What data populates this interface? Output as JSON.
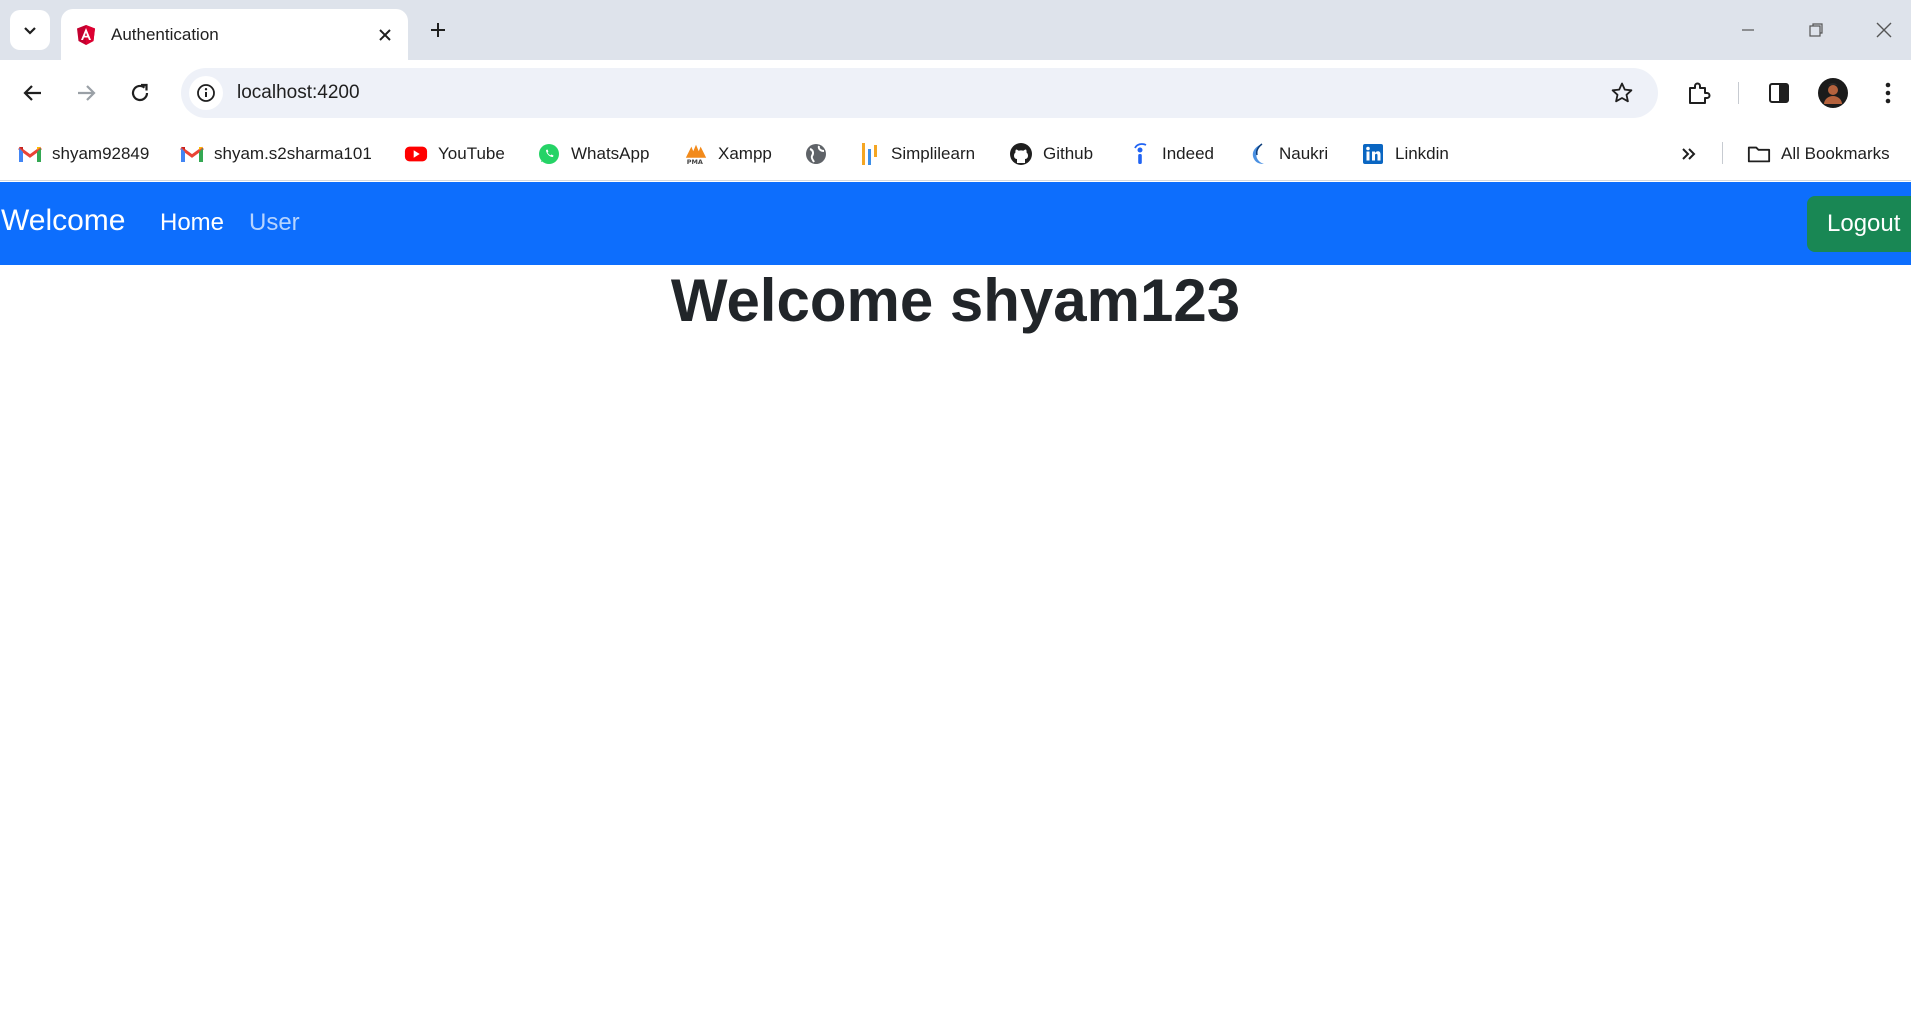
{
  "browser": {
    "tab_title": "Authentication",
    "url": "localhost:4200",
    "bookmarks": [
      {
        "label": "shyam92849",
        "icon": "gmail-icon"
      },
      {
        "label": "shyam.s2sharma101",
        "icon": "gmail-icon"
      },
      {
        "label": "YouTube",
        "icon": "youtube-icon"
      },
      {
        "label": "WhatsApp",
        "icon": "whatsapp-icon"
      },
      {
        "label": "Xampp",
        "icon": "xampp-icon"
      },
      {
        "label": "",
        "icon": "globe-icon"
      },
      {
        "label": "Simplilearn",
        "icon": "simplilearn-icon"
      },
      {
        "label": "Github",
        "icon": "github-icon"
      },
      {
        "label": "Indeed",
        "icon": "indeed-icon"
      },
      {
        "label": "Naukri",
        "icon": "naukri-icon"
      },
      {
        "label": "Linkdin",
        "icon": "linkedin-icon"
      }
    ],
    "all_bookmarks_label": "All Bookmarks"
  },
  "app": {
    "brand": "Welcome",
    "nav": [
      {
        "label": "Home",
        "active": true
      },
      {
        "label": "User",
        "active": false
      }
    ],
    "logout_label": "Logout",
    "headline": "Welcome shyam123",
    "colors": {
      "navbar": "#0d6efd",
      "logout": "#198754",
      "nav_inactive": "#b6d4fe"
    }
  }
}
